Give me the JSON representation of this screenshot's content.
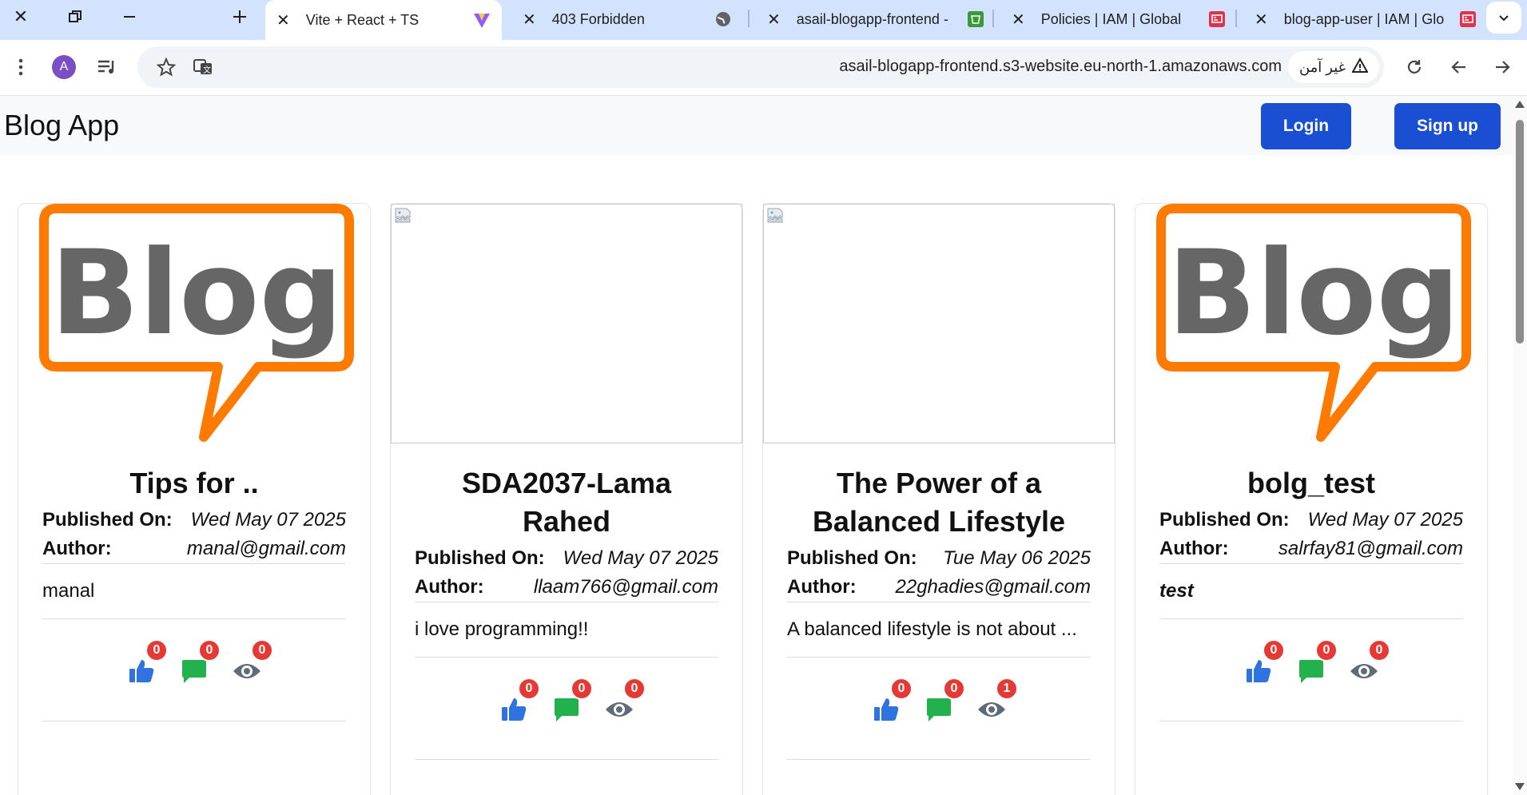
{
  "browser": {
    "tabs": [
      {
        "title": "Vite + React + TS",
        "icon": "vite-icon"
      },
      {
        "title": "403 Forbidden",
        "icon": "globe-icon"
      },
      {
        "title": "asail-blogapp-frontend -",
        "icon": "s3-bucket-icon"
      },
      {
        "title": "Policies | IAM | Global",
        "icon": "iam-icon"
      },
      {
        "title": "blog-app-user | IAM | Glo",
        "icon": "iam-icon"
      }
    ],
    "avatar_letter": "A",
    "url": "asail-blogapp-frontend.s3-website.eu-north-1.amazonaws.com",
    "security_label": "غير آمن",
    "colors": {
      "tabstrip": "#d3e3fd",
      "omnibox": "#f0f4f9",
      "avatar": "#7b4fc4"
    }
  },
  "navbar": {
    "brand": "Blog App",
    "login_label": "Login",
    "signup_label": "Sign up",
    "button_color": "#1a4fd4"
  },
  "labels": {
    "published_on": "Published On:",
    "author": "Author:"
  },
  "logo": {
    "text": "Blog",
    "text_color": "#666666",
    "bubble_color": "#ff7a00"
  },
  "posts": [
    {
      "image": "blog-logo",
      "title": "Tips for ..",
      "published": "Wed May 07 2025",
      "author": "manal@gmail.com",
      "excerpt": "manal",
      "likes": "0",
      "comments": "0",
      "views": "0"
    },
    {
      "image": "broken",
      "title": "SDA2037-Lama Rahed",
      "published": "Wed May 07 2025",
      "author": "llaam766@gmail.com",
      "excerpt": "i love programming!!",
      "likes": "0",
      "comments": "0",
      "views": "0"
    },
    {
      "image": "broken",
      "title": "The Power of a Balanced Lifestyle",
      "published": "Tue May 06 2025",
      "author": "22ghadies@gmail.com",
      "excerpt": "A balanced lifestyle is not about ...",
      "likes": "0",
      "comments": "0",
      "views": "1"
    },
    {
      "image": "blog-logo",
      "title": "bolg_test",
      "published": "Wed May 07 2025",
      "author": "salrfay81@gmail.com",
      "excerpt": "test",
      "likes": "0",
      "comments": "0",
      "views": "0"
    }
  ],
  "stat_colors": {
    "like": "#2f73e0",
    "comment": "#22b14c",
    "view": "#5f6b78",
    "badge": "#e53935"
  }
}
